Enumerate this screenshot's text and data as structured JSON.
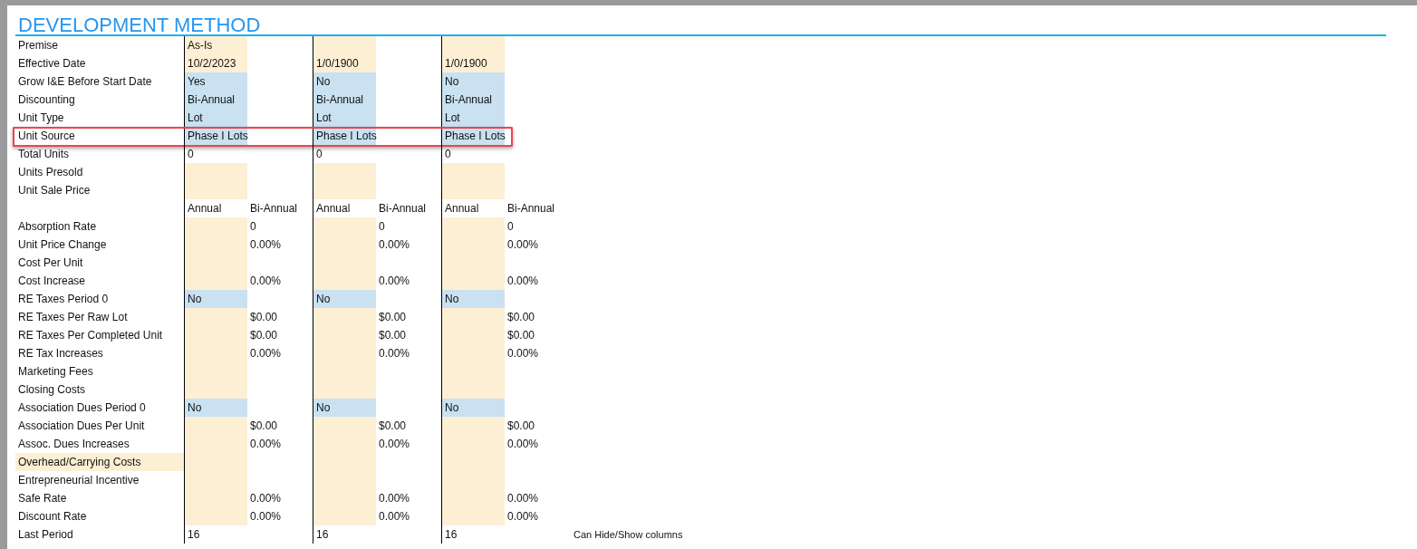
{
  "title": "DEVELOPMENT METHOD",
  "rows": [
    {
      "label": "Premise",
      "highlighted": false,
      "outlined": false,
      "cells": [
        {
          "text": "As-Is",
          "kind": "input"
        },
        {
          "kind": "plain"
        },
        {
          "kind": "input"
        },
        {
          "kind": "plain"
        },
        {
          "kind": "input"
        },
        {
          "kind": "plain"
        }
      ]
    },
    {
      "label": "Effective Date",
      "highlighted": false,
      "outlined": false,
      "cells": [
        {
          "text": "10/2/2023",
          "kind": "input"
        },
        {
          "kind": "plain"
        },
        {
          "text": "1/0/1900",
          "kind": "input"
        },
        {
          "kind": "plain"
        },
        {
          "text": "1/0/1900",
          "kind": "input"
        },
        {
          "kind": "plain"
        }
      ]
    },
    {
      "label": "Grow I&E Before Start Date",
      "highlighted": false,
      "outlined": false,
      "cells": [
        {
          "text": "Yes",
          "kind": "choice"
        },
        {
          "kind": "plain"
        },
        {
          "text": "No",
          "kind": "choice"
        },
        {
          "kind": "plain"
        },
        {
          "text": "No",
          "kind": "choice"
        },
        {
          "kind": "plain"
        }
      ]
    },
    {
      "label": "Discounting",
      "highlighted": false,
      "outlined": false,
      "cells": [
        {
          "text": "Bi-Annual",
          "kind": "choice"
        },
        {
          "kind": "plain"
        },
        {
          "text": "Bi-Annual",
          "kind": "choice"
        },
        {
          "kind": "plain"
        },
        {
          "text": "Bi-Annual",
          "kind": "choice"
        },
        {
          "kind": "plain"
        }
      ]
    },
    {
      "label": "Unit Type",
      "highlighted": false,
      "outlined": false,
      "cells": [
        {
          "text": "Lot",
          "kind": "choice"
        },
        {
          "kind": "plain"
        },
        {
          "text": "Lot",
          "kind": "choice"
        },
        {
          "kind": "plain"
        },
        {
          "text": "Lot",
          "kind": "choice"
        },
        {
          "kind": "plain"
        }
      ]
    },
    {
      "label": "Unit Source",
      "highlighted": false,
      "outlined": true,
      "cells": [
        {
          "text": "Phase I Lots",
          "kind": "choice"
        },
        {
          "kind": "plain"
        },
        {
          "text": "Phase I Lots",
          "kind": "choice"
        },
        {
          "kind": "plain"
        },
        {
          "text": "Phase I Lots",
          "kind": "choice"
        },
        {
          "kind": "plain"
        }
      ]
    },
    {
      "label": "Total Units",
      "highlighted": false,
      "outlined": false,
      "cells": [
        {
          "text": "0",
          "kind": "plain"
        },
        {
          "kind": "plain"
        },
        {
          "text": "0",
          "kind": "plain"
        },
        {
          "kind": "plain"
        },
        {
          "text": "0",
          "kind": "plain"
        },
        {
          "kind": "plain"
        }
      ]
    },
    {
      "label": "Units Presold",
      "highlighted": false,
      "outlined": false,
      "cells": [
        {
          "kind": "input"
        },
        {
          "kind": "plain"
        },
        {
          "kind": "input"
        },
        {
          "kind": "plain"
        },
        {
          "kind": "input"
        },
        {
          "kind": "plain"
        }
      ]
    },
    {
      "label": "Unit Sale Price",
      "highlighted": false,
      "outlined": false,
      "cells": [
        {
          "kind": "input"
        },
        {
          "kind": "plain"
        },
        {
          "kind": "input"
        },
        {
          "kind": "plain"
        },
        {
          "kind": "input"
        },
        {
          "kind": "plain"
        }
      ]
    },
    {
      "highlighted": false,
      "outlined": false,
      "cells": [
        {
          "text": "Annual",
          "kind": "plain"
        },
        {
          "text": "Bi-Annual",
          "kind": "plain"
        },
        {
          "text": "Annual",
          "kind": "plain"
        },
        {
          "text": "Bi-Annual",
          "kind": "plain"
        },
        {
          "text": "Annual",
          "kind": "plain"
        },
        {
          "text": "Bi-Annual",
          "kind": "plain"
        }
      ]
    },
    {
      "label": "Absorption Rate",
      "highlighted": false,
      "outlined": false,
      "cells": [
        {
          "kind": "input"
        },
        {
          "text": "0",
          "kind": "plain"
        },
        {
          "kind": "input"
        },
        {
          "text": "0",
          "kind": "plain"
        },
        {
          "kind": "input"
        },
        {
          "text": "0",
          "kind": "plain"
        }
      ]
    },
    {
      "label": "Unit Price Change",
      "highlighted": false,
      "outlined": false,
      "cells": [
        {
          "kind": "input"
        },
        {
          "text": "0.00%",
          "kind": "plain"
        },
        {
          "kind": "input"
        },
        {
          "text": "0.00%",
          "kind": "plain"
        },
        {
          "kind": "input"
        },
        {
          "text": "0.00%",
          "kind": "plain"
        }
      ]
    },
    {
      "label": "Cost Per Unit",
      "highlighted": false,
      "outlined": false,
      "cells": [
        {
          "kind": "input"
        },
        {
          "kind": "plain"
        },
        {
          "kind": "input"
        },
        {
          "kind": "plain"
        },
        {
          "kind": "input"
        },
        {
          "kind": "plain"
        }
      ]
    },
    {
      "label": "Cost Increase",
      "highlighted": false,
      "outlined": false,
      "cells": [
        {
          "kind": "input"
        },
        {
          "text": "0.00%",
          "kind": "plain"
        },
        {
          "kind": "input"
        },
        {
          "text": "0.00%",
          "kind": "plain"
        },
        {
          "kind": "input"
        },
        {
          "text": "0.00%",
          "kind": "plain"
        }
      ]
    },
    {
      "label": "RE Taxes Period 0",
      "highlighted": false,
      "outlined": false,
      "cells": [
        {
          "text": "No",
          "kind": "choice"
        },
        {
          "kind": "plain"
        },
        {
          "text": "No",
          "kind": "choice"
        },
        {
          "kind": "plain"
        },
        {
          "text": "No",
          "kind": "choice"
        },
        {
          "kind": "plain"
        }
      ]
    },
    {
      "label": "RE Taxes Per Raw Lot",
      "highlighted": false,
      "outlined": false,
      "cells": [
        {
          "kind": "input"
        },
        {
          "text": "$0.00",
          "kind": "plain"
        },
        {
          "kind": "input"
        },
        {
          "text": "$0.00",
          "kind": "plain"
        },
        {
          "kind": "input"
        },
        {
          "text": "$0.00",
          "kind": "plain"
        }
      ]
    },
    {
      "label": "RE Taxes Per Completed Unit",
      "highlighted": false,
      "outlined": false,
      "cells": [
        {
          "kind": "input"
        },
        {
          "text": "$0.00",
          "kind": "plain"
        },
        {
          "kind": "input"
        },
        {
          "text": "$0.00",
          "kind": "plain"
        },
        {
          "kind": "input"
        },
        {
          "text": "$0.00",
          "kind": "plain"
        }
      ]
    },
    {
      "label": "RE Tax Increases",
      "highlighted": false,
      "outlined": false,
      "cells": [
        {
          "kind": "input"
        },
        {
          "text": "0.00%",
          "kind": "plain"
        },
        {
          "kind": "input"
        },
        {
          "text": "0.00%",
          "kind": "plain"
        },
        {
          "kind": "input"
        },
        {
          "text": "0.00%",
          "kind": "plain"
        }
      ]
    },
    {
      "label": "Marketing Fees",
      "highlighted": false,
      "outlined": false,
      "cells": [
        {
          "kind": "input"
        },
        {
          "kind": "plain"
        },
        {
          "kind": "input"
        },
        {
          "kind": "plain"
        },
        {
          "kind": "input"
        },
        {
          "kind": "plain"
        }
      ]
    },
    {
      "label": "Closing Costs",
      "highlighted": false,
      "outlined": false,
      "cells": [
        {
          "kind": "input"
        },
        {
          "kind": "plain"
        },
        {
          "kind": "input"
        },
        {
          "kind": "plain"
        },
        {
          "kind": "input"
        },
        {
          "kind": "plain"
        }
      ]
    },
    {
      "label": "Association Dues Period 0",
      "highlighted": false,
      "outlined": false,
      "cells": [
        {
          "text": "No",
          "kind": "choice"
        },
        {
          "kind": "plain"
        },
        {
          "text": "No",
          "kind": "choice"
        },
        {
          "kind": "plain"
        },
        {
          "text": "No",
          "kind": "choice"
        },
        {
          "kind": "plain"
        }
      ]
    },
    {
      "label": "Association Dues Per Unit",
      "highlighted": false,
      "outlined": false,
      "cells": [
        {
          "kind": "input"
        },
        {
          "text": "$0.00",
          "kind": "plain"
        },
        {
          "kind": "input"
        },
        {
          "text": "$0.00",
          "kind": "plain"
        },
        {
          "kind": "input"
        },
        {
          "text": "$0.00",
          "kind": "plain"
        }
      ]
    },
    {
      "label": "Assoc. Dues Increases",
      "highlighted": false,
      "outlined": false,
      "cells": [
        {
          "kind": "input"
        },
        {
          "text": "0.00%",
          "kind": "plain"
        },
        {
          "kind": "input"
        },
        {
          "text": "0.00%",
          "kind": "plain"
        },
        {
          "kind": "input"
        },
        {
          "text": "0.00%",
          "kind": "plain"
        }
      ]
    },
    {
      "label": "Overhead/Carrying Costs",
      "highlighted": true,
      "outlined": false,
      "cells": [
        {
          "kind": "input"
        },
        {
          "kind": "plain"
        },
        {
          "kind": "input"
        },
        {
          "kind": "plain"
        },
        {
          "kind": "input"
        },
        {
          "kind": "plain"
        }
      ]
    },
    {
      "label": "Entrepreneurial Incentive",
      "highlighted": false,
      "outlined": false,
      "cells": [
        {
          "kind": "input"
        },
        {
          "kind": "plain"
        },
        {
          "kind": "input"
        },
        {
          "kind": "plain"
        },
        {
          "kind": "input"
        },
        {
          "kind": "plain"
        }
      ]
    },
    {
      "label": "Safe Rate",
      "highlighted": false,
      "outlined": false,
      "cells": [
        {
          "kind": "input"
        },
        {
          "text": "0.00%",
          "kind": "plain"
        },
        {
          "kind": "input"
        },
        {
          "text": "0.00%",
          "kind": "plain"
        },
        {
          "kind": "input"
        },
        {
          "text": "0.00%",
          "kind": "plain"
        }
      ]
    },
    {
      "label": "Discount Rate",
      "highlighted": false,
      "outlined": false,
      "cells": [
        {
          "kind": "input"
        },
        {
          "text": "0.00%",
          "kind": "plain"
        },
        {
          "kind": "input"
        },
        {
          "text": "0.00%",
          "kind": "plain"
        },
        {
          "kind": "input"
        },
        {
          "text": "0.00%",
          "kind": "plain"
        }
      ]
    },
    {
      "label": "Last Period",
      "highlighted": false,
      "outlined": false,
      "cells": [
        {
          "text": "16",
          "kind": "plain"
        },
        {
          "kind": "plain"
        },
        {
          "text": "16",
          "kind": "plain"
        },
        {
          "kind": "plain"
        },
        {
          "text": "16",
          "kind": "plain"
        },
        {
          "kind": "plain"
        }
      ]
    }
  ],
  "note": "Can Hide/Show columns"
}
